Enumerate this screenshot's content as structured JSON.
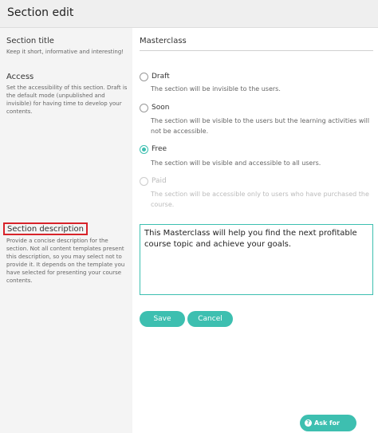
{
  "window": {
    "title": "Section edit"
  },
  "fields": {
    "title": {
      "label": "Section title",
      "hint": "Keep it short, informative and interesting!",
      "value": "Masterclass"
    },
    "access": {
      "label": "Access",
      "hint": "Set the accessibility of this section. Draft is the default mode (unpublished and invisible) for having time to develop your contents.",
      "selected": "Free",
      "options": [
        {
          "name": "Draft",
          "description": "The section will be invisible to the users."
        },
        {
          "name": "Soon",
          "description": "The section will be visible to the users but the learning activities will not be accessible."
        },
        {
          "name": "Free",
          "description": "The section will be visible and accessible to all users."
        },
        {
          "name": "Paid",
          "description": "The section will be accessible only to users who have purchased the course."
        }
      ]
    },
    "description": {
      "label": "Section description",
      "hint": "Provide a concise description for the section. Not all content templates present this description, so you may select not to provide it. It depends on the template you have selected for presenting your course contents.",
      "value": "This Masterclass will help you find the next profitable course topic and achieve your goals."
    }
  },
  "actions": {
    "save_label": "Save",
    "cancel_label": "Cancel"
  },
  "help": {
    "label": "Ask for help",
    "icon": "question-icon"
  },
  "colors": {
    "accent": "#3dbfb0",
    "highlight_border": "#d8232a"
  }
}
